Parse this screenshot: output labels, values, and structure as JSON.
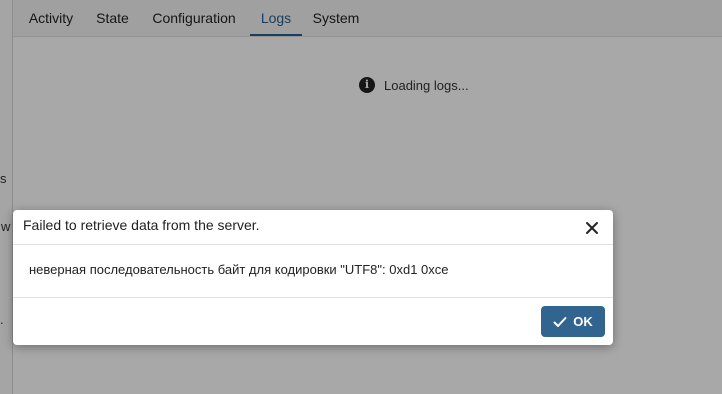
{
  "left_fragments": [
    "s",
    "w",
    "."
  ],
  "tabs": [
    {
      "label": "Activity",
      "active": false
    },
    {
      "label": "State",
      "active": false
    },
    {
      "label": "Configuration",
      "active": false
    },
    {
      "label": "Logs",
      "active": true
    },
    {
      "label": "System",
      "active": false
    }
  ],
  "logs": {
    "loading_text": "Loading logs...",
    "icon": "info-icon"
  },
  "dialog": {
    "title": "Failed to retrieve data from the server.",
    "message": "неверная последовательность байт для кодировки \"UTF8\": 0xd1 0xce",
    "ok_label": "OK",
    "close_icon": "close-icon",
    "ok_icon": "check-icon"
  },
  "colors": {
    "accent": "#326490",
    "active_tab": "#2a5f8f"
  }
}
